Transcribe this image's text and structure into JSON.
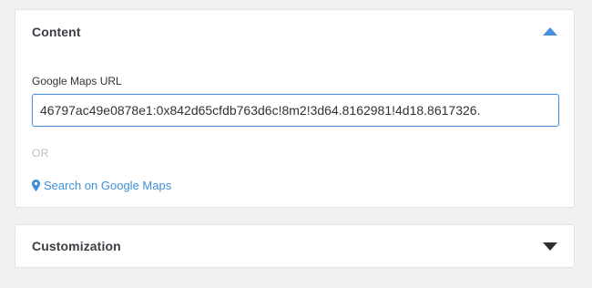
{
  "content_panel": {
    "title": "Content",
    "expanded": true,
    "caret_icon": "caret-up-icon",
    "field_label": "Google Maps URL",
    "url_value": ".46797ac49e0878e1:0x842d65cfdb763d6c!8m2!3d64.8162981!4d18.8617326",
    "or_text": "OR",
    "search_link": {
      "icon": "map-marker-icon",
      "label": "Search on Google Maps"
    }
  },
  "customization_panel": {
    "title": "Customization",
    "expanded": false,
    "caret_icon": "caret-down-icon"
  },
  "colors": {
    "accent": "#4a90e2",
    "link": "#3d8fd8",
    "muted": "#bdbdbd",
    "background": "#f1f1f1"
  }
}
